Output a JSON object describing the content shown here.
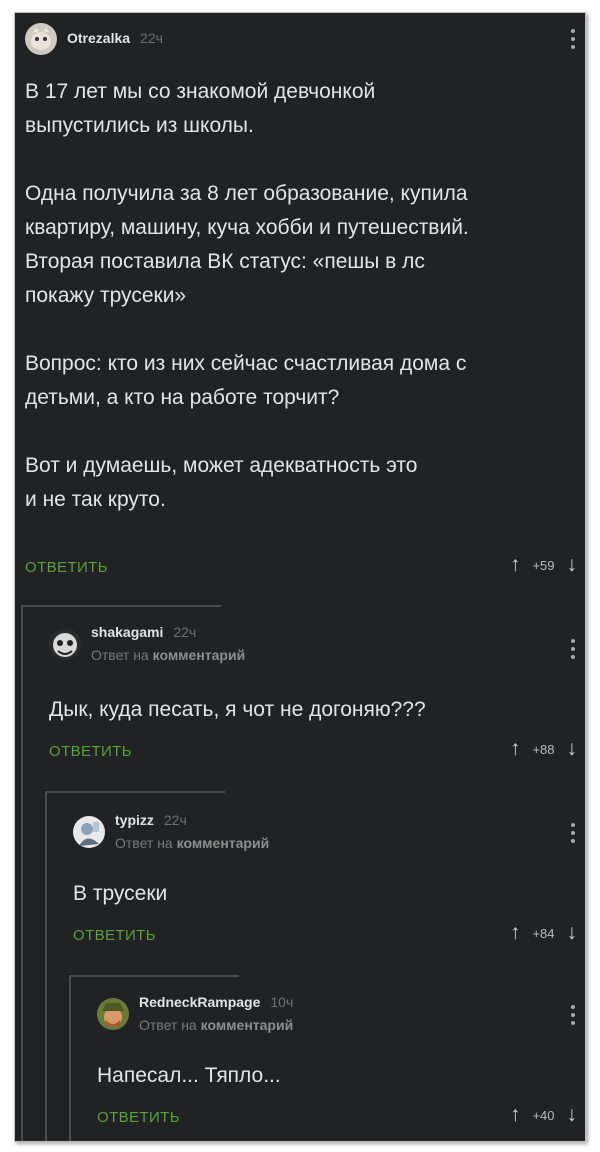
{
  "reply_label": "ОТВЕТИТЬ",
  "arrows": {
    "up": "↑",
    "down": "↓"
  },
  "colors": {
    "background": "#212223",
    "reply": "#5aa23a",
    "text": "#e4e4e4"
  },
  "comments": [
    {
      "user": "Otrezalka",
      "time": "22ч",
      "body": "В 17 лет мы со знакомой девчонкой\nвыпустились из школы.\n\nОдна получила за 8 лет образование, купила\nквартиру, машину, куча хобби и путешествий.\nВторая поставила ВК статус: «пешы в лс\nпокажу трусеки»\n\nВопрос: кто из них сейчас счастливая дома с\nдетьми, а кто на работе торчит?\n\nВот и думаешь, может адекватность это\nи не так круто.",
      "score": "+59"
    },
    {
      "user": "shakagami",
      "time": "22ч",
      "reply_prefix": "Ответ на",
      "reply_target": "комментарий",
      "body": "Дык, куда песать, я чот не догоняю???",
      "score": "+88"
    },
    {
      "user": "typizz",
      "time": "22ч",
      "reply_prefix": "Ответ на",
      "reply_target": "комментарий",
      "body": "В трусеки",
      "score": "+84"
    },
    {
      "user": "RedneckRampage",
      "time": "10ч",
      "reply_prefix": "Ответ на",
      "reply_target": "комментарий",
      "body": "Напесал... Тяпло...",
      "score": "+40"
    }
  ]
}
